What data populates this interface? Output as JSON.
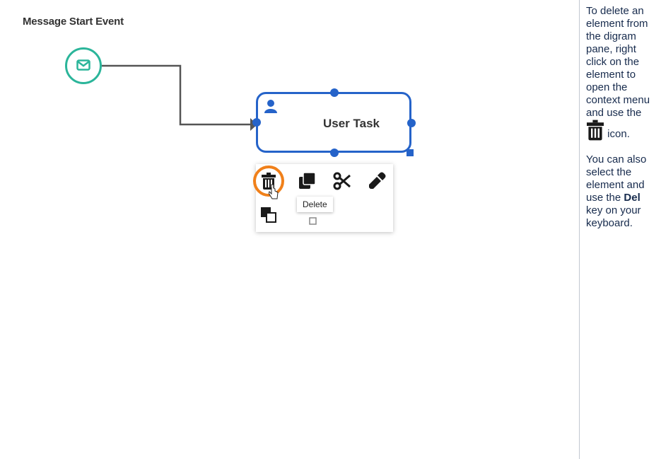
{
  "diagram": {
    "section_title": "Message Start Event",
    "task_label": "User Task",
    "tooltip_label": "Delete",
    "colors": {
      "start_event": "#2bb59a",
      "task": "#2563c9",
      "highlight": "#f0801a",
      "connector": "#555555"
    },
    "context_menu": {
      "items": [
        {
          "name": "delete",
          "icon": "trash-icon"
        },
        {
          "name": "duplicate",
          "icon": "copy-icon"
        },
        {
          "name": "cut",
          "icon": "scissors-icon"
        },
        {
          "name": "color",
          "icon": "eyedropper-icon"
        },
        {
          "name": "bring-front",
          "icon": "layers-icon"
        },
        {
          "name": "send-back",
          "icon": "layers-outline-icon"
        }
      ]
    }
  },
  "instructions": {
    "p1_text_before_icon": "To delete an element from the digram pane, right click on the element to open the context menu and use the",
    "p1_text_after_icon": "icon.",
    "p2_text_before_key": "You can also select the element and use the",
    "p2_key": "Del",
    "p2_text_after_key": "key on your keyboard."
  }
}
